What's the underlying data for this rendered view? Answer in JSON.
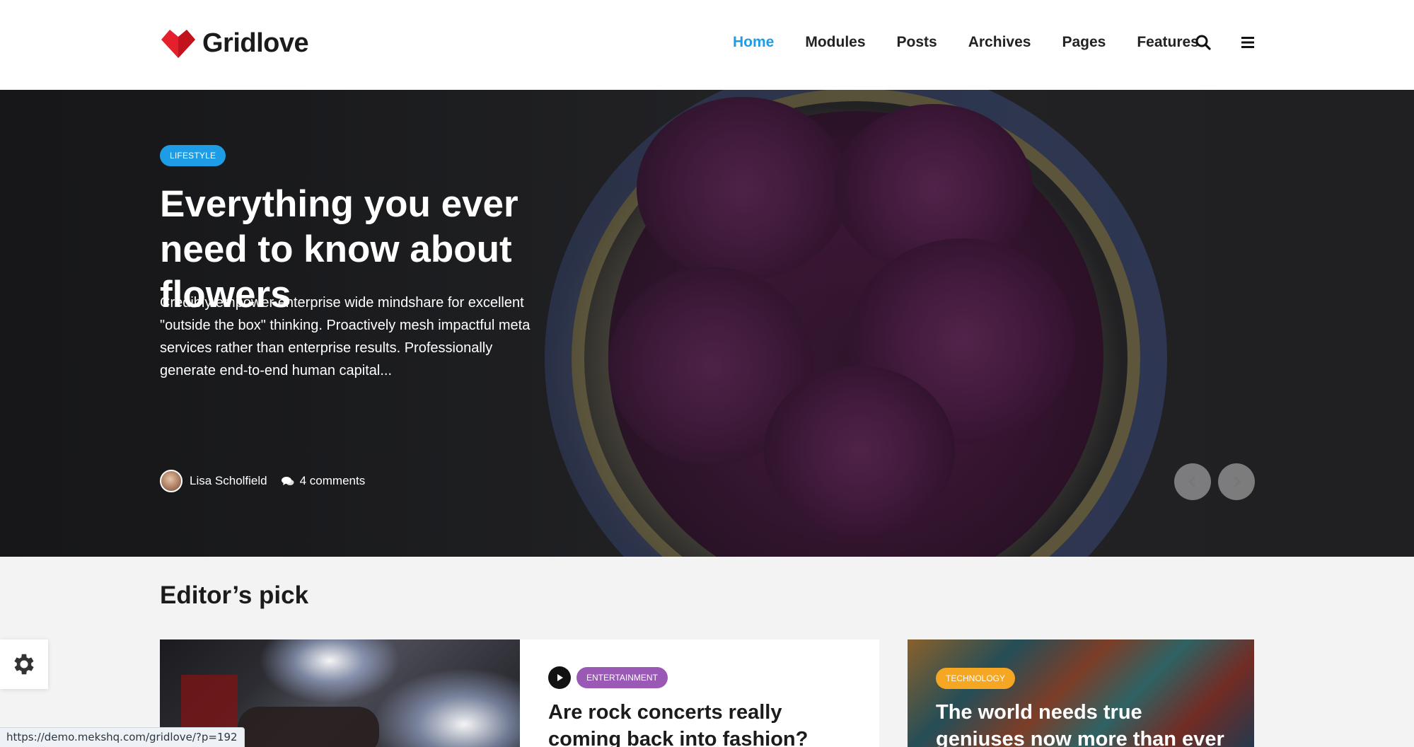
{
  "brand": {
    "name": "Gridlove"
  },
  "nav": {
    "items": [
      {
        "label": "Home",
        "active": true
      },
      {
        "label": "Modules",
        "active": false
      },
      {
        "label": "Posts",
        "active": false
      },
      {
        "label": "Archives",
        "active": false
      },
      {
        "label": "Pages",
        "active": false
      },
      {
        "label": "Features",
        "active": false
      }
    ],
    "icons": [
      "search-icon",
      "hamburger-menu-icon"
    ]
  },
  "hero": {
    "category": "LIFESTYLE",
    "title": "Everything you ever need to know about flowers",
    "excerpt": "Credibly empower enterprise wide mindshare for excellent \"outside the box\" thinking. Proactively mesh impactful meta services rather than enterprise results. Professionally generate end-to-end human capital...",
    "author": "Lisa Scholfield",
    "comments": "4 comments"
  },
  "editors_pick": {
    "title": "Editor’s pick",
    "cards": [
      {
        "category": "ENTERTAINMENT",
        "title": "Are rock concerts really coming back into fashion?",
        "has_video": true
      },
      {
        "category": "TECHNOLOGY",
        "title": "The world needs true geniuses now more than ever"
      }
    ]
  },
  "status_bar": {
    "url": "https://demo.mekshq.com/gridlove/?p=192"
  },
  "colors": {
    "accent": "#1e9de6",
    "brand_red": "#e4202d",
    "entertainment": "#9b59b6",
    "technology": "#f5a623"
  }
}
